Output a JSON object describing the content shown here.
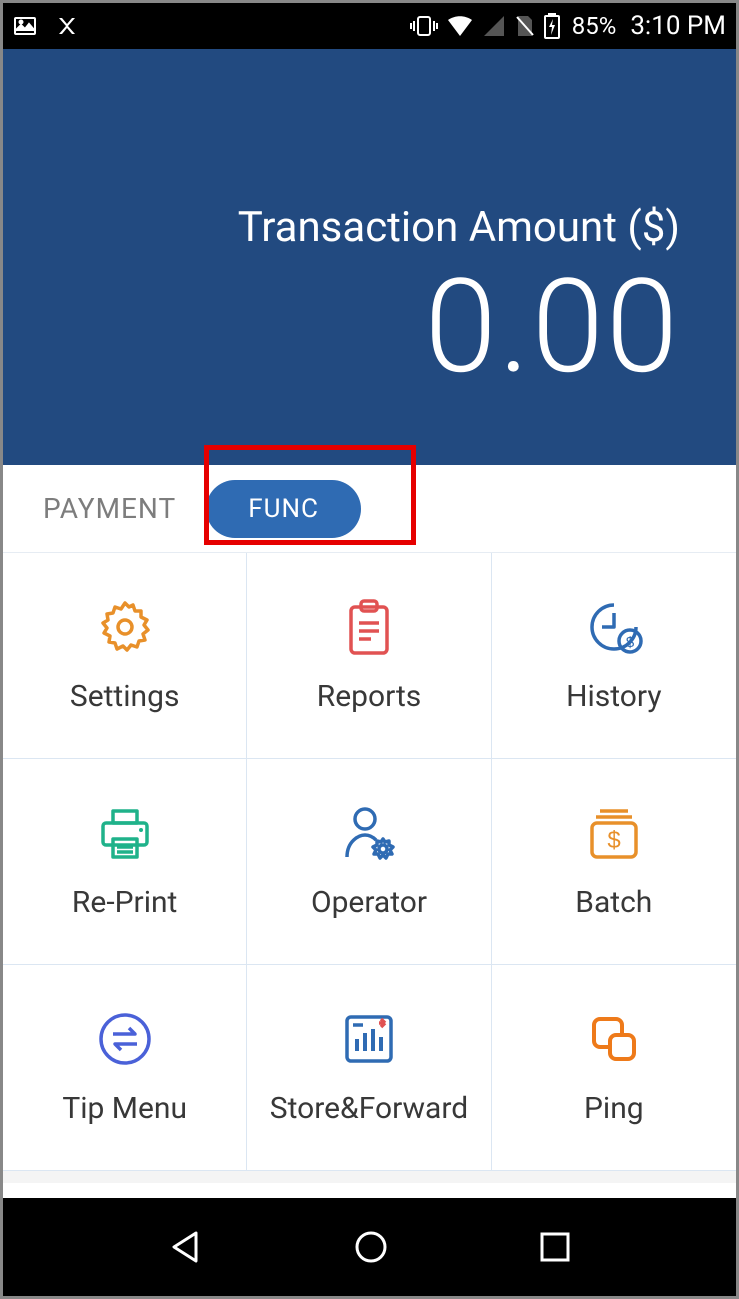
{
  "status": {
    "battery_pct": "85%",
    "time": "3:10 PM"
  },
  "header": {
    "label": "Transaction Amount ($)",
    "amount": "0.00"
  },
  "tabs": {
    "payment": "PAYMENT",
    "func": "FUNC"
  },
  "grid": [
    {
      "id": "settings",
      "label": "Settings",
      "icon": "gear",
      "color": "#e8902a"
    },
    {
      "id": "reports",
      "label": "Reports",
      "icon": "clipboard",
      "color": "#e15252"
    },
    {
      "id": "history",
      "label": "History",
      "icon": "clock-dollar",
      "color": "#2f6bb3"
    },
    {
      "id": "reprint",
      "label": "Re-Print",
      "icon": "printer",
      "color": "#1fb28a"
    },
    {
      "id": "operator",
      "label": "Operator",
      "icon": "person-gear",
      "color": "#2f6bb3"
    },
    {
      "id": "batch",
      "label": "Batch",
      "icon": "money-stack",
      "color": "#e8902a"
    },
    {
      "id": "tipmenu",
      "label": "Tip Menu",
      "icon": "swap",
      "color": "#4a61d8"
    },
    {
      "id": "storeforward",
      "label": "Store&Forward",
      "icon": "chart-box",
      "color": "#2f6bb3"
    },
    {
      "id": "ping",
      "label": "Ping",
      "icon": "squares",
      "color": "#ee7a1a"
    }
  ]
}
